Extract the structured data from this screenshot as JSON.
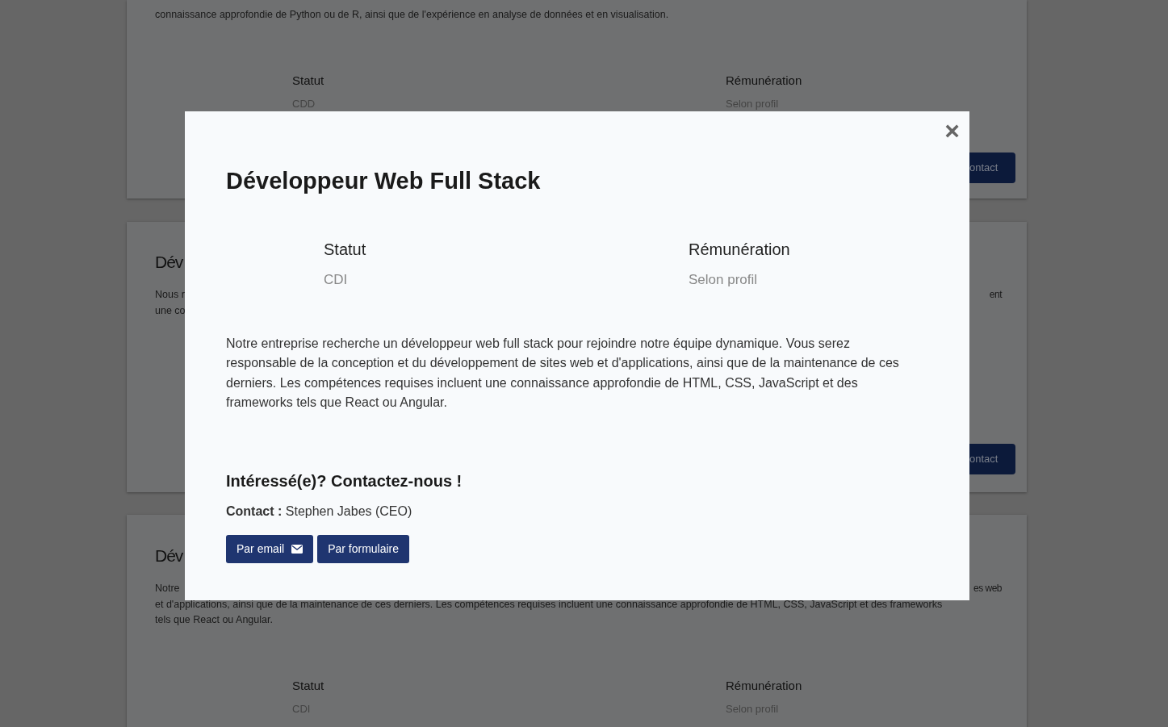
{
  "background_cards": [
    {
      "description_lines": [
        {
          "left": "connaissance approfondie de Python ou de R, ainsi que de l'expérience en analyse de données et en visualisation."
        }
      ],
      "status": {
        "label": "Statut",
        "value": "CDD"
      },
      "pay": {
        "label": "Rémunération",
        "value": "Selon profil"
      },
      "button": "ontact"
    },
    {
      "title": "Dév",
      "description_lines": [
        {
          "left": "Nous r",
          "right": "ent"
        },
        {
          "left": "une co"
        }
      ],
      "button": "ontact"
    },
    {
      "title": "Dév",
      "description_lines": [
        {
          "left": "Notre",
          "right": "es web"
        },
        {
          "left": "et d'applications, ainsi que de la maintenance de ces derniers. Les compétences requises incluent une connaissance approfondie de HTML, CSS, JavaScript et des frameworks"
        },
        {
          "left": "tels que React ou Angular."
        }
      ],
      "status": {
        "label": "Statut",
        "value": "CDI"
      },
      "pay": {
        "label": "Rémunération",
        "value": "Selon profil"
      }
    }
  ],
  "modal": {
    "close": "×",
    "title": "Développeur Web Full Stack",
    "status": {
      "label": "Statut",
      "value": "CDI"
    },
    "pay": {
      "label": "Rémunération",
      "value": "Selon profil"
    },
    "description": "Notre entreprise recherche un développeur web full stack pour rejoindre notre équipe dynamique. Vous serez responsable de la conception et du développement de sites web et d'applications, ainsi que de la maintenance de ces derniers. Les compétences requises incluent une connaissance approfondie de HTML, CSS, JavaScript et des frameworks tels que React ou Angular.",
    "contact_heading": "Intéressé(e)? Contactez-nous !",
    "contact_line": "**Contact :** Stephen Jabes (CEO)",
    "buttons": [
      {
        "label": "Par email",
        "kind": "email"
      },
      {
        "label": "Par formulaire",
        "kind": "plain"
      }
    ]
  }
}
